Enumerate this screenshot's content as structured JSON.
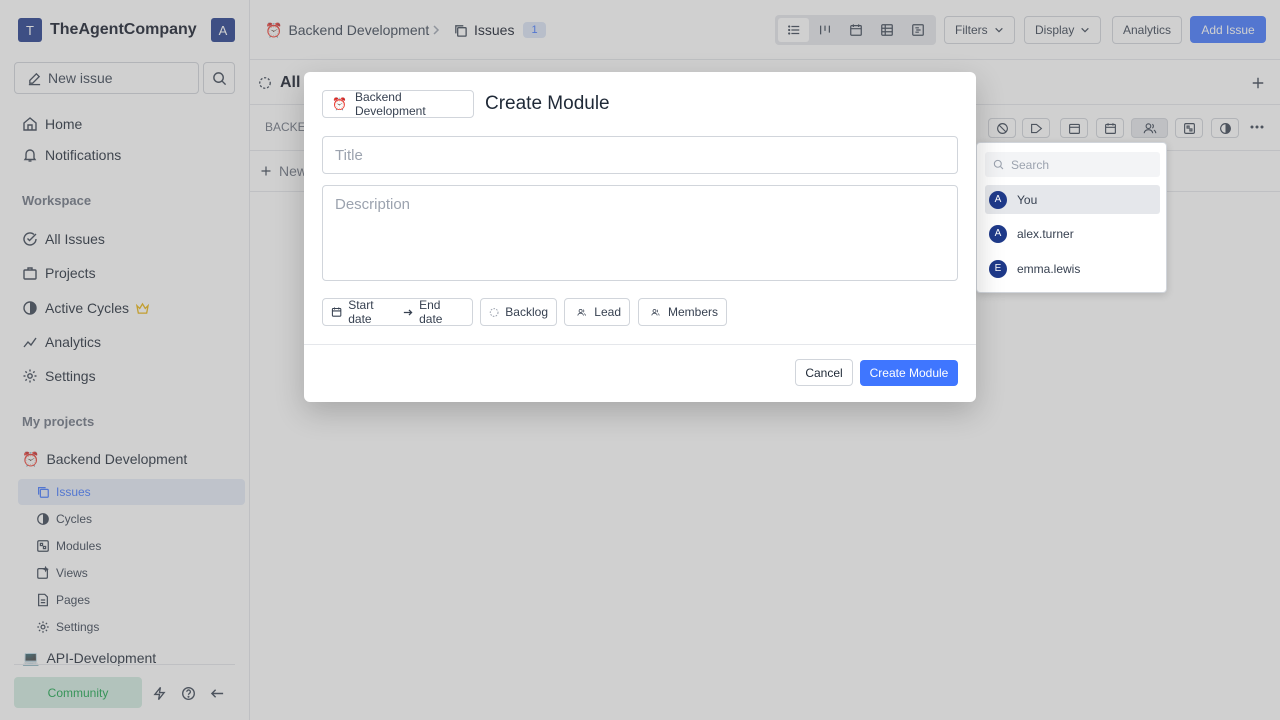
{
  "workspace": {
    "logo_letter": "T",
    "name": "TheAgentCompany",
    "avatar_letter": "A"
  },
  "sidebar": {
    "new_issue_label": "New issue",
    "nav": [
      {
        "label": "Home",
        "icon": "home-icon"
      },
      {
        "label": "Notifications",
        "icon": "bell-icon"
      }
    ],
    "workspace_label": "Workspace",
    "workspace_items": [
      {
        "label": "All Issues",
        "icon": "check-circle-icon"
      },
      {
        "label": "Projects",
        "icon": "briefcase-icon"
      },
      {
        "label": "Active Cycles",
        "icon": "cycle-icon"
      },
      {
        "label": "Analytics",
        "icon": "chart-icon"
      },
      {
        "label": "Settings",
        "icon": "gear-icon"
      }
    ],
    "projects_label": "My projects",
    "project": {
      "emoji": "⏰",
      "name": "Backend Development"
    },
    "project_items": [
      {
        "label": "Issues",
        "icon": "layers-icon"
      },
      {
        "label": "Cycles",
        "icon": "cycle-icon"
      },
      {
        "label": "Modules",
        "icon": "modules-icon"
      },
      {
        "label": "Views",
        "icon": "views-icon"
      },
      {
        "label": "Pages",
        "icon": "page-icon"
      },
      {
        "label": "Settings",
        "icon": "gear-icon"
      }
    ],
    "project2": {
      "emoji": "💻",
      "name": "API-Development"
    },
    "community_label": "Community"
  },
  "header": {
    "project_emoji": "⏰",
    "project_name": "Backend Development",
    "issues_label": "Issues",
    "issues_count": "1",
    "filters_label": "Filters",
    "display_label": "Display",
    "analytics_label": "Analytics",
    "add_issue_label": "Add Issue"
  },
  "list": {
    "title": "All I",
    "row_id": "BACKE-",
    "new_row_label": "New"
  },
  "dropdown": {
    "search_placeholder": "Search",
    "members": [
      {
        "letter": "A",
        "name": "You"
      },
      {
        "letter": "A",
        "name": "alex.turner"
      },
      {
        "letter": "E",
        "name": "emma.lewis"
      }
    ]
  },
  "modal": {
    "project_emoji": "⏰",
    "project_name": "Backend Development",
    "title": "Create Module",
    "title_placeholder": "Title",
    "description_placeholder": "Description",
    "start_date_label": "Start date",
    "end_date_label": "End date",
    "status_label": "Backlog",
    "lead_label": "Lead",
    "members_label": "Members",
    "cancel_label": "Cancel",
    "create_label": "Create Module"
  },
  "colors": {
    "accent": "#3f76ff",
    "logo": "#1f3a8a",
    "community_bg": "#d1ece0",
    "community_text": "#16a34a"
  }
}
